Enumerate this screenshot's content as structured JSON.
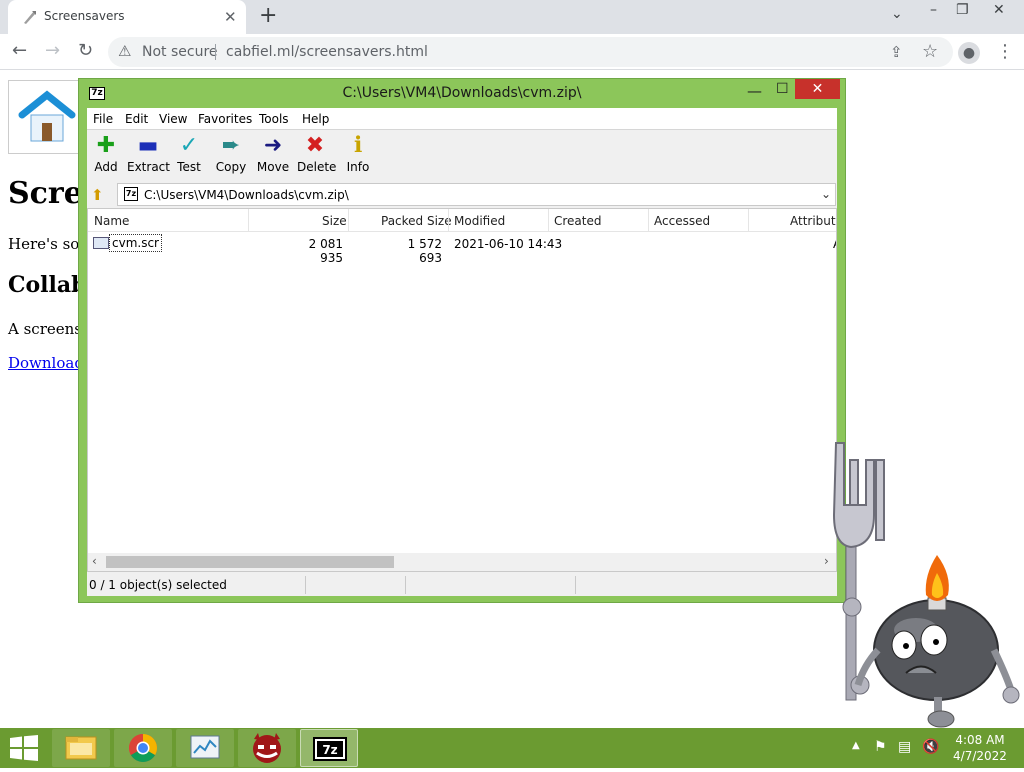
{
  "browser": {
    "tab_title": "Screensavers",
    "security_label": "Not secure",
    "url": "cabfiel.ml/screensavers.html"
  },
  "page": {
    "heading": "Scree",
    "intro": "Here's som",
    "subheading": "Collab",
    "desc": "A screensa",
    "download_link": "Download"
  },
  "zip_window": {
    "app_icon_label": "7z",
    "title": "C:\\Users\\VM4\\Downloads\\cvm.zip\\",
    "menu": [
      "File",
      "Edit",
      "View",
      "Favorites",
      "Tools",
      "Help"
    ],
    "toolbar": [
      {
        "label": "Add",
        "icon": "plus-icon",
        "color": "#1aa01a"
      },
      {
        "label": "Extract",
        "icon": "minus-icon",
        "color": "#1c2fb8"
      },
      {
        "label": "Test",
        "icon": "check-icon",
        "color": "#1aa7b5"
      },
      {
        "label": "Copy",
        "icon": "copy-arrow-icon",
        "color": "#2a8a8a"
      },
      {
        "label": "Move",
        "icon": "move-arrow-icon",
        "color": "#1a1a80"
      },
      {
        "label": "Delete",
        "icon": "delete-x-icon",
        "color": "#d42020"
      },
      {
        "label": "Info",
        "icon": "info-icon",
        "color": "#c8a400"
      }
    ],
    "address": "C:\\Users\\VM4\\Downloads\\cvm.zip\\",
    "columns": [
      "Name",
      "Size",
      "Packed Size",
      "Modified",
      "Created",
      "Accessed",
      "Attribute"
    ],
    "rows": [
      {
        "name": "cvm.scr",
        "size": "2 081 935",
        "packed": "1 572 693",
        "modified": "2021-06-10 14:43",
        "created": "",
        "accessed": "",
        "attribute": "A"
      }
    ],
    "status": "0 / 1 object(s) selected"
  },
  "taskbar": {
    "apps": [
      "file-explorer",
      "chrome",
      "task-manager",
      "bonzi-app",
      "7zip"
    ],
    "time": "4:08 AM",
    "date": "4/7/2022"
  }
}
